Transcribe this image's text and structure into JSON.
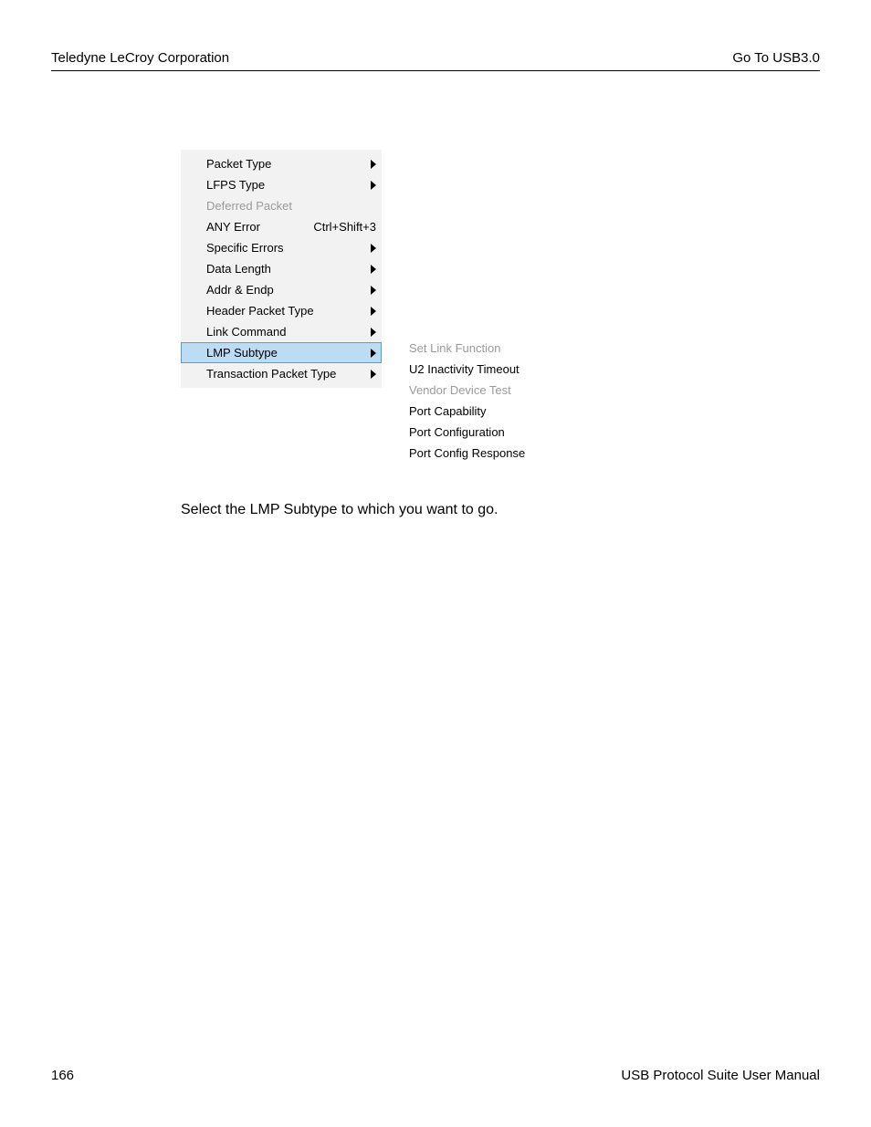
{
  "header": {
    "left": "Teledyne LeCroy Corporation",
    "right": "Go To USB3.0"
  },
  "menu": {
    "items": [
      {
        "label": "Packet Type",
        "hasSubmenu": true,
        "disabled": false
      },
      {
        "label": "LFPS Type",
        "hasSubmenu": true,
        "disabled": false
      },
      {
        "label": "Deferred Packet",
        "hasSubmenu": false,
        "disabled": true
      },
      {
        "label": "ANY Error",
        "shortcut": "Ctrl+Shift+3",
        "hasSubmenu": false,
        "disabled": false
      },
      {
        "label": "Specific Errors",
        "hasSubmenu": true,
        "disabled": false
      },
      {
        "label": "Data Length",
        "hasSubmenu": true,
        "disabled": false
      },
      {
        "label": "Addr & Endp",
        "hasSubmenu": true,
        "disabled": false
      },
      {
        "label": "Header Packet Type",
        "hasSubmenu": true,
        "disabled": false
      },
      {
        "label": "Link Command",
        "hasSubmenu": true,
        "disabled": false
      },
      {
        "label": "LMP Subtype",
        "hasSubmenu": true,
        "disabled": false,
        "highlighted": true
      },
      {
        "label": "Transaction Packet Type",
        "hasSubmenu": true,
        "disabled": false
      }
    ]
  },
  "submenu": {
    "items": [
      {
        "label": "Set Link Function",
        "disabled": true
      },
      {
        "label": "U2 Inactivity Timeout",
        "disabled": false
      },
      {
        "label": "Vendor Device Test",
        "disabled": true
      },
      {
        "label": "Port Capability",
        "disabled": false
      },
      {
        "label": "Port Configuration",
        "disabled": false
      },
      {
        "label": "Port Config Response",
        "disabled": false
      }
    ]
  },
  "bodyText": "Select the LMP Subtype to which you want to go.",
  "footer": {
    "left": "166",
    "right": "USB Protocol Suite User Manual"
  }
}
